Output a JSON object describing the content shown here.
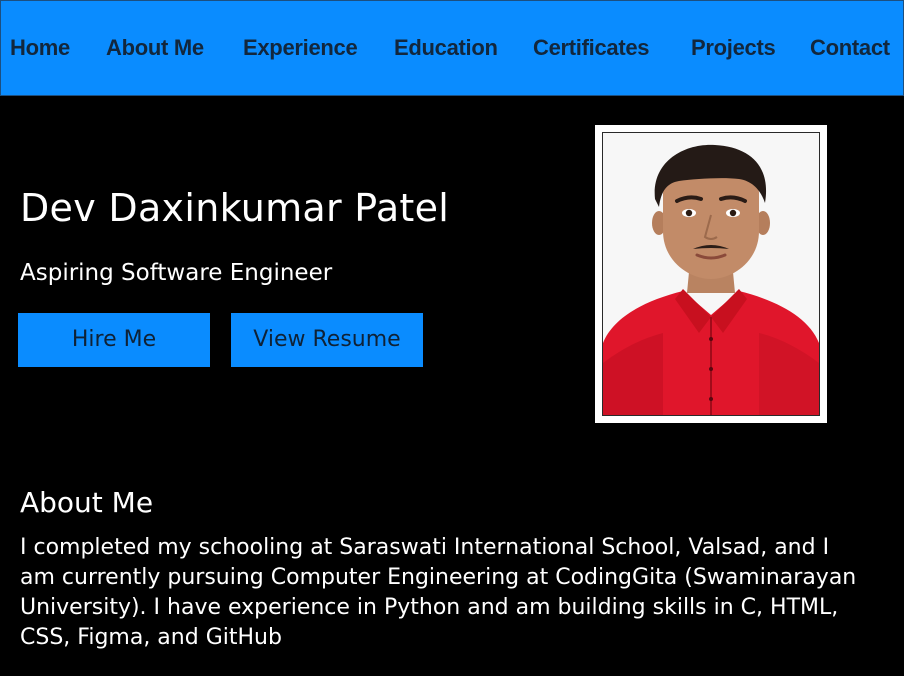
{
  "nav": {
    "items": [
      {
        "label": "Home"
      },
      {
        "label": "About Me"
      },
      {
        "label": "Experience"
      },
      {
        "label": "Education"
      },
      {
        "label": "Certificates"
      },
      {
        "label": "Projects"
      },
      {
        "label": "Contact"
      }
    ]
  },
  "hero": {
    "name": "Dev Daxinkumar Patel",
    "tagline": "Aspiring Software Engineer",
    "hire_label": "Hire Me",
    "resume_label": "View Resume",
    "photo_icon": "profile-photo"
  },
  "about": {
    "title": "About Me",
    "text": "I completed my schooling at Saraswati International School, Valsad, and I\nam currently pursuing Computer Engineering at CodingGita (Swaminarayan\nUniversity). I have experience in Python and am building skills in C, HTML,\nCSS, Figma, and GitHub"
  },
  "colors": {
    "accent": "#0a8cff",
    "background": "#000000",
    "text": "#ffffff",
    "shirt": "#e0162b"
  }
}
